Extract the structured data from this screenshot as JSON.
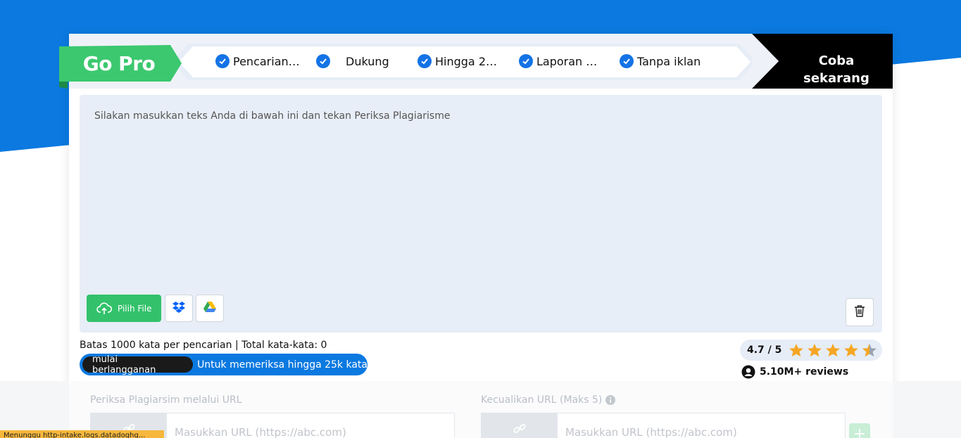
{
  "colors": {
    "brand_blue": "#0b79e0",
    "green": "#33c26b",
    "dark": "#111111",
    "editor_bg": "#e8eef7"
  },
  "header": {
    "gopro_label": "Go Pro",
    "features": [
      {
        "label": "Pencarian ...",
        "icon": "check-circle-icon"
      },
      {
        "label": "Dukung",
        "icon": "check-circle-icon"
      },
      {
        "label": "Hingga 25,...",
        "icon": "check-circle-icon"
      },
      {
        "label": "Laporan A...",
        "icon": "check-circle-icon"
      },
      {
        "label": "Tanpa iklan",
        "icon": "check-circle-icon"
      }
    ],
    "cta_line1": "Coba",
    "cta_line2": "sekarang"
  },
  "editor": {
    "placeholder": "Silakan masukkan teks Anda di bawah ini dan tekan Periksa Plagiarisme",
    "upload_label": "Pilih File",
    "upload_icon": "cloud-upload-icon",
    "dropbox_icon": "dropbox-icon",
    "drive_icon": "google-drive-icon",
    "trash_icon": "trash-icon"
  },
  "info": {
    "limit_text": "Batas 1000 kata per pencarian | Total kata-kata: 0",
    "subscribe_label": "mulai berlangganan",
    "subscribe_text": "Untuk memeriksa hingga 25k kata"
  },
  "rating": {
    "value": "4.7 / 5",
    "stars": 4.7,
    "reviews": "5.10M+ reviews"
  },
  "lower": {
    "url_label": "Periksa Plagiarsim melalui URL",
    "exclude_label": "Kecualikan URL (Maks 5)",
    "url_placeholder": "Masukkan URL (https://abc.com)",
    "exclude_placeholder": "Masukkan URL (https://abc.com)",
    "add_label": "+"
  },
  "status_bar": {
    "text": "Menunggu http-intake.logs.datadoghq..."
  }
}
